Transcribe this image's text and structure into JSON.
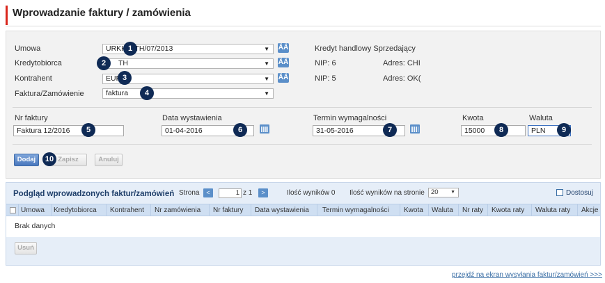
{
  "page": {
    "title": "Wprowadzanie faktury / zamówienia"
  },
  "form": {
    "umowa": {
      "label": "Umowa",
      "value": "URKH/...TH/07/2013",
      "badge": "1"
    },
    "kredytobiorca": {
      "label": "Kredytobiorca",
      "value": "TH",
      "badge": "2"
    },
    "kontrahent": {
      "label": "Kontrahent",
      "value": "EUR",
      "badge": "3"
    },
    "faktura_zamowienie": {
      "label": "Faktura/Zamówienie",
      "value": "faktura",
      "badge": "4"
    },
    "info": {
      "kredyt_title": "Kredyt handlowy Sprzedający",
      "nip1": "NIP: 6",
      "adres1": "Adres: CHI",
      "nip2": "NIP: 5",
      "adres2": "Adres: OK("
    },
    "nr_faktury": {
      "label": "Nr faktury",
      "value": "Faktura 12/2016",
      "badge": "5"
    },
    "data_wystawienia": {
      "label": "Data wystawienia",
      "value": "01-04-2016",
      "badge": "6"
    },
    "termin_wymagalnosci": {
      "label": "Termin wymagalności",
      "value": "31-05-2016",
      "badge": "7"
    },
    "kwota": {
      "label": "Kwota",
      "value": "15000",
      "badge": "8"
    },
    "waluta": {
      "label": "Waluta",
      "value": "PLN",
      "badge": "9"
    },
    "buttons": {
      "dodaj": "Dodaj",
      "zapisz": "Zapisz",
      "anuluj": "Anuluj",
      "badge": "10"
    }
  },
  "grid": {
    "title": "Podgląd wprowadzonych faktur/zamówień",
    "strona_label": "Strona",
    "page_value": "1",
    "of_pages": "z 1",
    "results_count": "Ilość wyników 0",
    "per_page_label": "Ilość wyników na stronie",
    "per_page_value": "20",
    "customize_label": "Dostosuj",
    "columns": [
      "Umowa",
      "Kredytobiorca",
      "Kontrahent",
      "Nr zamówienia",
      "Nr faktury",
      "Data wystawienia",
      "Termin wymagalności",
      "Kwota",
      "Waluta",
      "Nr raty",
      "Kwota raty",
      "Waluta raty",
      "Akcje"
    ],
    "empty_text": "Brak danych",
    "delete_label": "Usuń"
  },
  "footer": {
    "link": "przejdź na ekran wysyłania faktur/zamówień >>>"
  },
  "colors": {
    "accent": "#d9261c",
    "badge": "#0f2a55",
    "button_blue": "#4a78bd",
    "grid_bg": "#e6eef8"
  }
}
